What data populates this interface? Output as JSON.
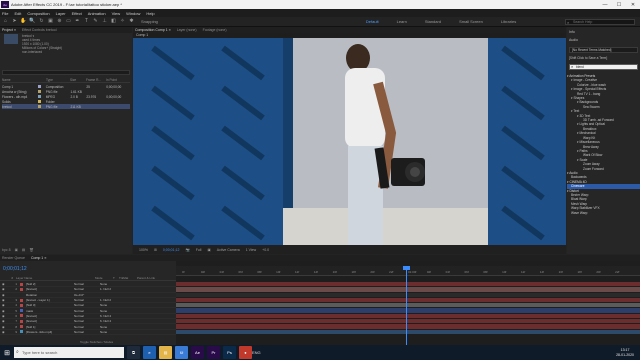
{
  "window": {
    "title": "Adobe After Effects CC 2019 - F:\\ae tutorial\\tattoo sticker.aep *",
    "minimize": "—",
    "maximize": "☐",
    "close": "✕"
  },
  "menu": [
    "File",
    "Edit",
    "Composition",
    "Layer",
    "Effect",
    "Animation",
    "View",
    "Window",
    "Help"
  ],
  "toolbar": {
    "snapping": "Snapping",
    "workspaces": [
      "Default",
      "Learn",
      "Standard",
      "Small Screen",
      "Libraries"
    ],
    "active_workspace": "Default",
    "search_placeholder": "Search Help"
  },
  "project": {
    "tabs": [
      "Project ≡",
      "Effect Controls bretool"
    ],
    "thumb_info": [
      "bretool ▾",
      "used 4 times",
      "1920 x 1080 (1.00)",
      "",
      "Millions of Colors+ (Straight)",
      "non-interlaced"
    ],
    "columns": [
      "Name",
      "",
      "Type",
      "Size",
      "Frame R...",
      "In Point"
    ],
    "items": [
      {
        "name": "Comp 1",
        "type": "Composition",
        "size": "",
        "fr": "25",
        "in": "0;00;00;00",
        "color": "#9aa0c7"
      },
      {
        "name": "Arrocha w (Sting)",
        "type": "PNG file",
        "size": "1.61 KB",
        "fr": "",
        "in": "",
        "color": "#b3a36a"
      },
      {
        "name": "Flowers - alh.mp4",
        "type": "MPEG",
        "size": "2.0 B",
        "fr": "23.976",
        "in": "0;00;00;00",
        "color": "#7fa0b8"
      },
      {
        "name": "Solids",
        "type": "Folder",
        "size": "",
        "fr": "",
        "in": "",
        "color": "#d1b35a"
      },
      {
        "name": "bretool",
        "type": "PNG file",
        "size": "211 KB",
        "fr": "",
        "in": "",
        "color": "#b3a36a"
      }
    ],
    "footer": [
      "bpc 8",
      "▣",
      "▤",
      "🗑"
    ]
  },
  "composition": {
    "tabs": [
      "Composition Comp 1 ≡",
      "Layer (none)",
      "Footage (none)"
    ],
    "active_tab": "Composition Comp 1 ≡",
    "subtab": "Comp 1",
    "viewer_bar": [
      "100%",
      "⊞",
      "0;00;01;12",
      "📷",
      "Full",
      "▣",
      "Active Camera",
      "1 View",
      "+0.0"
    ]
  },
  "effects": {
    "tabs": [
      "Info",
      "Audio",
      "Effects & Presets ≡"
    ],
    "preset_box": "[No Recent Terms Matched]",
    "save_term": "[Shift Click to Save a Term]",
    "search_value": "blend",
    "items": [
      {
        "t": "▾ Animation Presets",
        "c": "cat"
      },
      {
        "t": "▾ Image - Creative",
        "c": "l1"
      },
      {
        "t": "Colorize - blue wash",
        "c": "l2"
      },
      {
        "t": "▾ Image - Special Effects",
        "c": "l1"
      },
      {
        "t": "Red TV 1 - bang",
        "c": "l2"
      },
      {
        "t": "▾ Shapes",
        "c": "l1"
      },
      {
        "t": "▾ Backgrounds",
        "c": "l2"
      },
      {
        "t": "Sea Swarm",
        "c": "l3"
      },
      {
        "t": "▾ Text",
        "c": "l1"
      },
      {
        "t": "▾ 3D Text",
        "c": "l2"
      },
      {
        "t": "3D Tumb..ad Forward",
        "c": "l3"
      },
      {
        "t": "▾ Lights and Optical",
        "c": "l2"
      },
      {
        "t": "Breakbox",
        "c": "l3"
      },
      {
        "t": "▾ Mechanical",
        "c": "l2"
      },
      {
        "t": "Warp Kit",
        "c": "l3"
      },
      {
        "t": "▾ Miscellaneous",
        "c": "l2"
      },
      {
        "t": "Brew Away",
        "c": "l3"
      },
      {
        "t": "▾ Paths",
        "c": "l2"
      },
      {
        "t": "Wark Of Blow",
        "c": "l3"
      },
      {
        "t": "▾ Scale",
        "c": "l2"
      },
      {
        "t": "Zoom Away",
        "c": "l3"
      },
      {
        "t": "Zoom Forward",
        "c": "l3"
      },
      {
        "t": "▾ Audio",
        "c": "cat"
      },
      {
        "t": "Backwards",
        "c": "l1"
      },
      {
        "t": "▾ CINEMA 4D",
        "c": "cat"
      },
      {
        "t": "Cineware",
        "c": "l1"
      },
      {
        "t": "▾ Distort",
        "c": "cat"
      },
      {
        "t": "Bezier Warp",
        "c": "l1"
      },
      {
        "t": "Bloat Warp",
        "c": "l1"
      },
      {
        "t": "Mesh Warp",
        "c": "l1"
      },
      {
        "t": "Warp Stabilizer VFX",
        "c": "l1"
      },
      {
        "t": "Wave Warp",
        "c": "l1"
      }
    ],
    "selected_index": 25
  },
  "timeline": {
    "tabs": [
      "Render Queue",
      "Comp 1 ≡"
    ],
    "timecode": "0;00;01;12",
    "ruler": [
      "0f",
      "02f",
      "04f",
      "06f",
      "08f",
      "10f",
      "12f",
      "14f",
      "16f",
      "18f",
      "20f",
      "22f",
      "01:00f",
      "02f",
      "04f",
      "06f",
      "08f",
      "10f",
      "12f",
      "14f",
      "16f",
      "18f",
      "20f",
      "22f"
    ],
    "header": [
      "#",
      "Layer Name",
      "Mode",
      "T",
      "TrkMat",
      "Parent & Link"
    ],
    "layers": [
      {
        "n": "1",
        "name": "[Null 2]",
        "mode": "Normal",
        "par": "None",
        "color": "#b84545",
        "bar": "#6b2d2d"
      },
      {
        "n": "2",
        "name": "[bretool]",
        "mode": "Normal",
        "par": "1. Null 2",
        "color": "#b84545",
        "bar": "#6b4a4a"
      },
      {
        "n": "",
        "name": "Rotation",
        "mode": "0x+0.0°",
        "par": "",
        "color": "#262626",
        "bar": "#2a2a2a"
      },
      {
        "n": "3",
        "name": "[bretool - Layer 1]",
        "mode": "Normal",
        "par": "1. Null 2",
        "color": "#b84545",
        "bar": "#6b2d2d"
      },
      {
        "n": "4",
        "name": "[Null 3]",
        "mode": "Normal",
        "par": "None",
        "color": "#b84545",
        "bar": "#5b5b5b"
      },
      {
        "n": "5",
        "name": "mask",
        "mode": "Normal",
        "par": "None",
        "color": "#4560b8",
        "bar": "#2d3e6b"
      },
      {
        "n": "6",
        "name": "[bretool]",
        "mode": "Normal",
        "par": "6. Null 4",
        "color": "#b84545",
        "bar": "#6b2d2d"
      },
      {
        "n": "7",
        "name": "[bretool]",
        "mode": "Normal",
        "par": "6. Null 4",
        "color": "#b84545",
        "bar": "#6b2d2d"
      },
      {
        "n": "8",
        "name": "[Null 1]",
        "mode": "Normal",
        "par": "None",
        "color": "#b84545",
        "bar": "#6b2d2d"
      },
      {
        "n": "9",
        "name": "[Flowers..nldo.mp4]",
        "mode": "Normal",
        "par": "None",
        "color": "#4590b8",
        "bar": "#2d4a6b"
      }
    ],
    "footer": "Toggle Switches / Modes"
  },
  "taskbar": {
    "search_placeholder": "Type here to search",
    "apps": [
      {
        "label": "⧉",
        "color": "#1e2a3a"
      },
      {
        "label": "e",
        "color": "#1f5fb0"
      },
      {
        "label": "▤",
        "color": "#e3b44a"
      },
      {
        "label": "⛁",
        "color": "#3a7bd5"
      },
      {
        "label": "Ae",
        "color": "#2a0b4a"
      },
      {
        "label": "Pr",
        "color": "#2a0b4a"
      },
      {
        "label": "Ps",
        "color": "#0b2a4a"
      },
      {
        "label": "●",
        "color": "#c0392b"
      }
    ],
    "time": "13:17",
    "date": "28-01-2020",
    "tray": "ENG"
  },
  "colors": {
    "accent": "#3a8cff",
    "timecode": "#3f8ff0"
  }
}
